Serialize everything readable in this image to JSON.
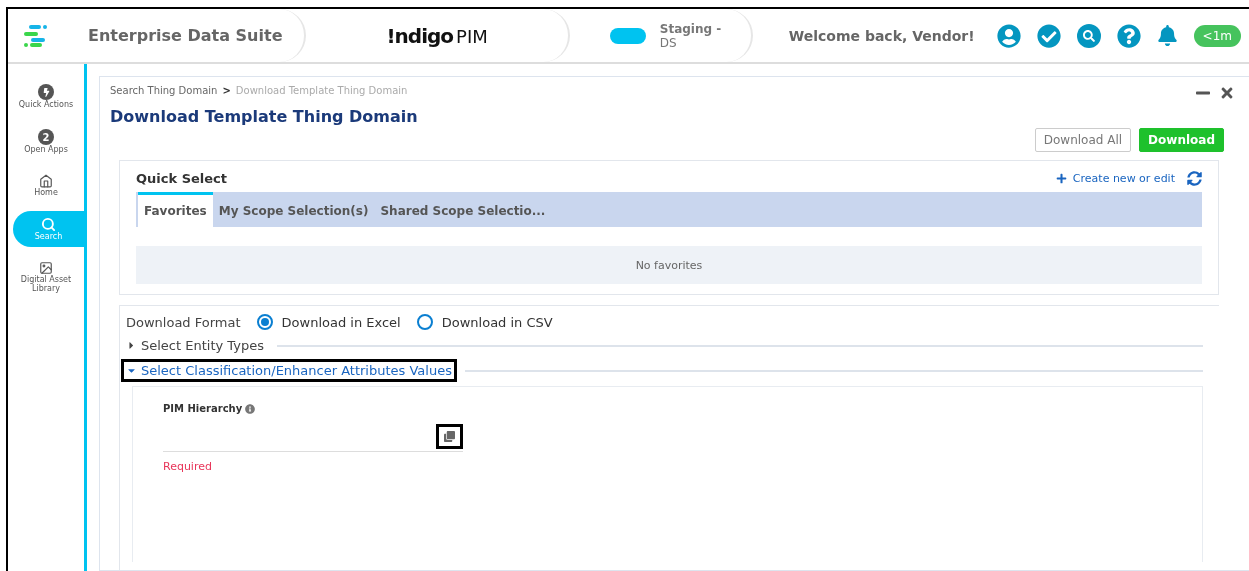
{
  "header": {
    "suite": "Enterprise Data Suite",
    "logo_bold": "!ndigo",
    "logo_light": "PIM",
    "env_title": "Staging -",
    "env_sub": "DS",
    "welcome": "Welcome back,  Vendor!",
    "timer": "<1m"
  },
  "sidebar": {
    "items": [
      {
        "kind": "bolt",
        "label": "Quick Actions",
        "selected": false
      },
      {
        "kind": "badge",
        "badge": "2",
        "label": "Open Apps",
        "selected": false
      },
      {
        "kind": "home",
        "label": "Home",
        "selected": false
      },
      {
        "kind": "search",
        "label": "Search",
        "selected": true
      },
      {
        "kind": "image",
        "label": "Digital Asset Library",
        "selected": false
      }
    ]
  },
  "breadcrumb": {
    "parent": "Search Thing Domain",
    "separator": ">",
    "current": "Download Template Thing Domain"
  },
  "title": "Download Template Thing Domain",
  "buttons": [
    {
      "label": "Download All",
      "kind": "secondary"
    },
    {
      "label": "Download",
      "kind": "primary"
    }
  ],
  "quick_select": {
    "title": "Quick Select",
    "create": "Create new or edit",
    "tabs": [
      {
        "label": "Favorites",
        "selected": true
      },
      {
        "label": "My Scope Selection(s)",
        "selected": false
      },
      {
        "label": "Shared Scope Selectio...",
        "selected": false
      }
    ],
    "empty": "No favorites"
  },
  "format": {
    "label": "Download Format",
    "options": [
      {
        "label": "Download in Excel",
        "selected": true
      },
      {
        "label": "Download in CSV",
        "selected": false
      }
    ]
  },
  "sections": [
    {
      "label": "Select Entity Types",
      "expanded": false,
      "highlighted": false
    },
    {
      "label": "Select Classification/Enhancer Attributes Values",
      "expanded": true,
      "highlighted": true
    }
  ],
  "field": {
    "label": "PIM Hierarchy",
    "error": "Required"
  }
}
